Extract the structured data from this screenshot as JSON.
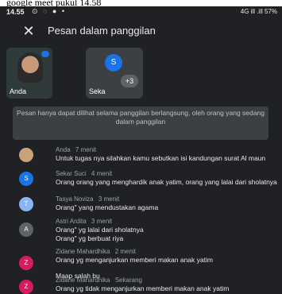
{
  "top_caption": "google meet pukul 14.58",
  "statusbar": {
    "time": "14.55",
    "right": "4G ill .ill 57%"
  },
  "header": {
    "title": "Pesan dalam panggilan"
  },
  "tiles": {
    "self_name": "Anda",
    "other_initial": "S",
    "other_name": "Seka",
    "more_count": "+3"
  },
  "notice": "Pesan hanya dapat dilihat selama panggilan berlangsung, oleh orang yang sedang dalam panggilan",
  "messages": [
    {
      "sender": "Anda",
      "time": "7 menit",
      "avatar_color": "#c8a27a",
      "lines": [
        "Untuk tugas nya silahkan kamu sebutkan isi kandungan surat Al maun"
      ]
    },
    {
      "sender": "Sekar Suci",
      "time": "4 menit",
      "initial": "S",
      "avatar_color": "#1a73e8",
      "lines": [
        "Orang orang yang menghardik anak yatim, orang yang lalai dari sholatnya"
      ]
    },
    {
      "sender": "Tasya Noviza",
      "time": "3 menit",
      "initial": "T",
      "avatar_color": "#8ab4f8",
      "lines": [
        "Orang\" yang mendustakan agama"
      ]
    },
    {
      "sender": "Astri Ardita",
      "time": "3 menit",
      "initial": "A",
      "avatar_color": "#5f6368",
      "lines": [
        "Orang\" yg lalai dari sholatnya",
        "Orang\" yg berbuat riya"
      ]
    },
    {
      "sender": "Zidane Mahardhika",
      "time": "2 menit",
      "initial": "Z",
      "avatar_color": "#d81b60",
      "lines": [
        "Orang yg menganjurkan memberi makan anak yatim",
        "Maap salah bu"
      ]
    },
    {
      "sender": "Zidane Mahardhika",
      "time": "Sekarang",
      "initial": "Z",
      "avatar_color": "#d81b60",
      "lines": [
        "Orang yg tidak menganjurkan memberi makan anak yatim"
      ]
    }
  ]
}
